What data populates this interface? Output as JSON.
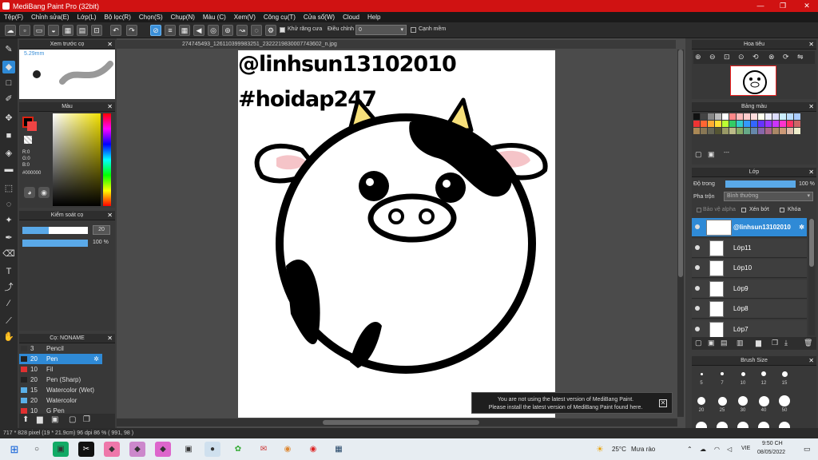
{
  "window": {
    "title": "MediBang Paint Pro (32bit)"
  },
  "menu": [
    "Tệp(F)",
    "Chỉnh sửa(E)",
    "Lớp(L)",
    "Bộ lọc(R)",
    "Chọn(S)",
    "Chụp(N)",
    "Màu (C)",
    "Xem(V)",
    "Công cụ(T)",
    "Cửa sổ(W)",
    "Cloud",
    "Help"
  ],
  "toolbar": {
    "antialias_label": "Khử răng cưa",
    "correction_label": "Điều chỉnh",
    "correction_value": "0",
    "edge_label": "Cạnh mềm"
  },
  "document": {
    "filename": "274745493_1261103999832​51_2322219830007743602_n.jpg"
  },
  "canvas_text": {
    "line1": "@linhsun13102010",
    "line2": "#hoidap247"
  },
  "preview_panel": {
    "title": "Xem trước cọ",
    "size": "5.29mm"
  },
  "color_panel": {
    "title": "Màu",
    "r": "R:0",
    "g": "G:0",
    "b": "B:0",
    "hex": "#000000"
  },
  "brush_control": {
    "title": "Kiểm soát cọ",
    "size": "20",
    "opacity": "100 %"
  },
  "brush_list": {
    "title": "Cọ: NONAME",
    "items": [
      {
        "size": "3",
        "name": "Pencil",
        "color": "#333333"
      },
      {
        "size": "20",
        "name": "Pen",
        "color": "#222222"
      },
      {
        "size": "10",
        "name": "Fil",
        "color": "#e03030"
      },
      {
        "size": "20",
        "name": "Pen (Sharp)",
        "color": "#222222"
      },
      {
        "size": "15",
        "name": "Watercolor (Wet)",
        "color": "#5ab0e8"
      },
      {
        "size": "20",
        "name": "Watercolor",
        "color": "#5ab0e8"
      },
      {
        "size": "10",
        "name": "G Pen",
        "color": "#e03030"
      }
    ]
  },
  "navigator": {
    "title": "Hoa tiêu"
  },
  "swatch_panel": {
    "title": "Bảng màu",
    "dashes": "---"
  },
  "layer_panel": {
    "title": "Lớp",
    "opacity_label": "Độ trong",
    "opacity_value": "100 %",
    "blend_label": "Pha trộn",
    "blend_value": "Bình thường",
    "protect_alpha": "Bảo vệ alpha",
    "clipping": "Xén bớt",
    "lock": "Khóa",
    "layers": [
      {
        "name": "@linhsun13102010"
      },
      {
        "name": "Lớp11"
      },
      {
        "name": "Lớp10"
      },
      {
        "name": "Lớp9"
      },
      {
        "name": "Lớp8"
      },
      {
        "name": "Lớp7"
      }
    ]
  },
  "brush_size_panel": {
    "title": "Brush Size",
    "labels": [
      "5",
      "7",
      "10",
      "12",
      "15",
      "20",
      "25",
      "30",
      "40",
      "50"
    ]
  },
  "notification": {
    "line1": "You are not using the latest version of MediBang Paint.",
    "line2": "Please install the latest version of MediBang Paint found here."
  },
  "status": {
    "text": "717 * 828 pixel   (19 * 21.9cm)   96 dpi   86 %   ( 991, 98 )"
  },
  "taskbar": {
    "weather_temp": "25°C",
    "weather_desc": "Mưa rào",
    "lang": "VIE",
    "time": "9:50 CH",
    "date": "08/05/2022"
  },
  "colors": {
    "title_red": "#d01212",
    "accent_blue": "#2f8ad6"
  }
}
